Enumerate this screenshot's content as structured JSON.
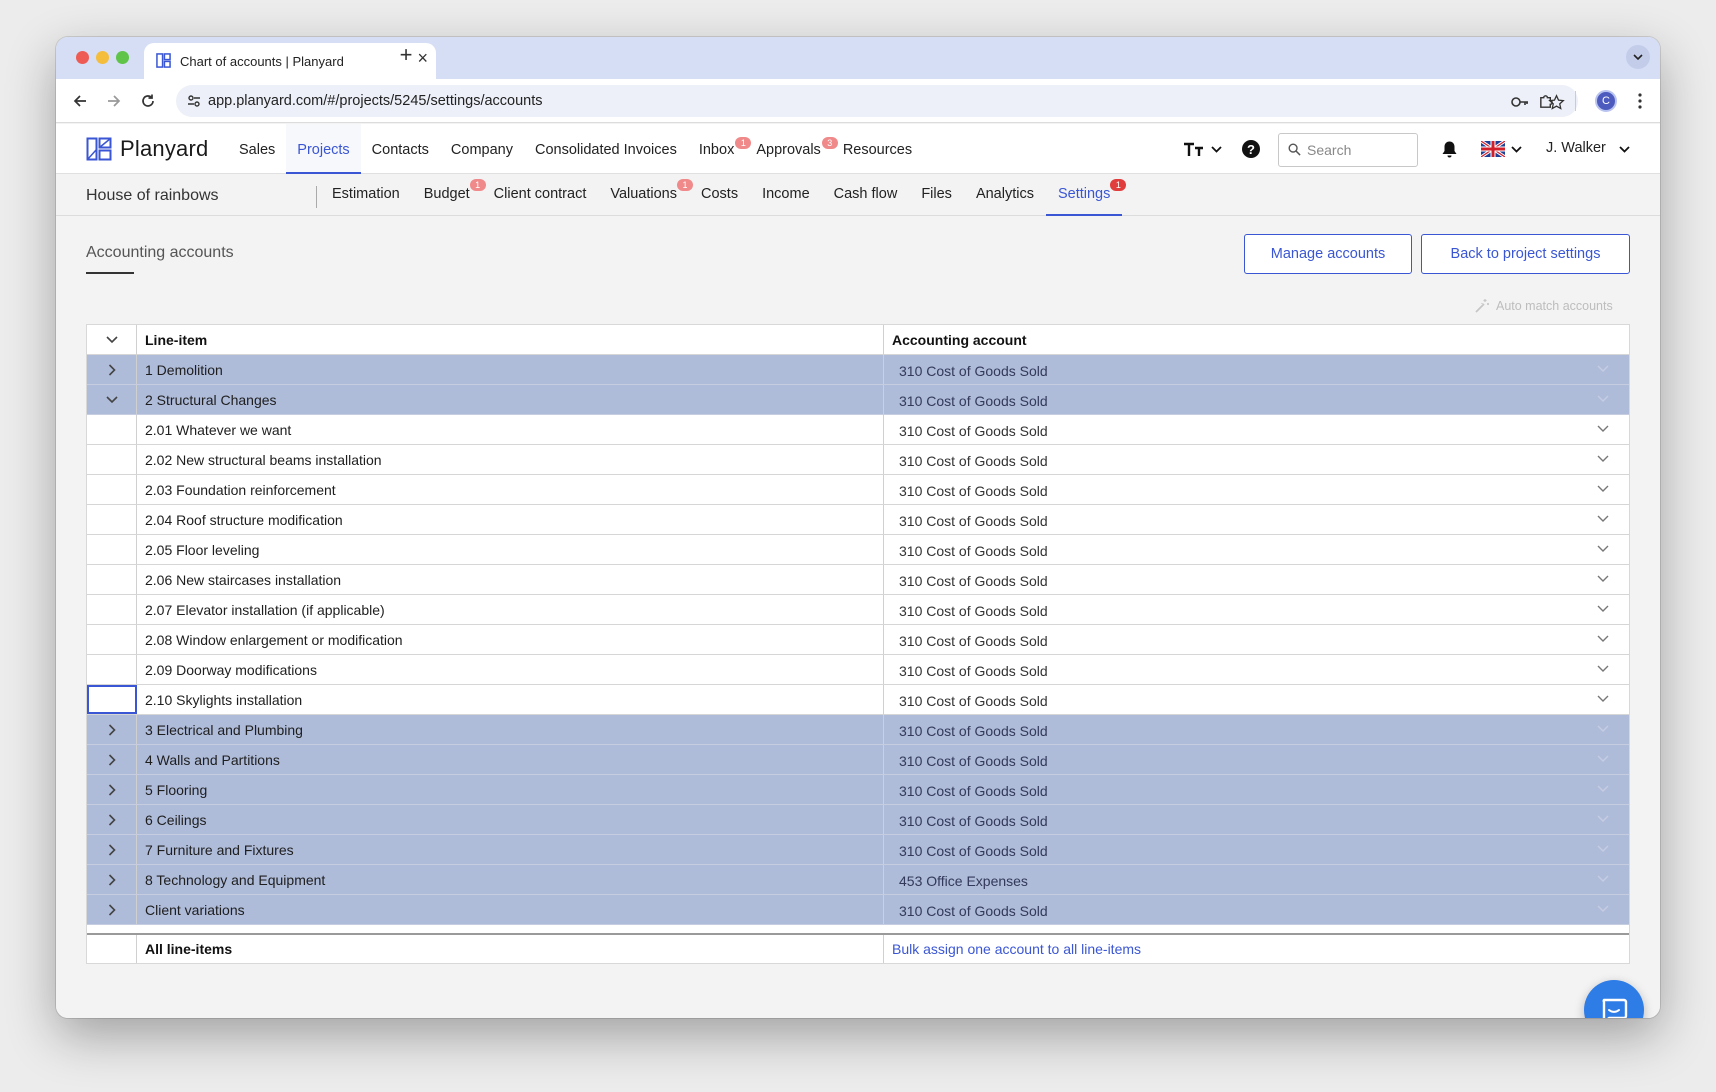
{
  "browser": {
    "tab_title": "Chart of accounts | Planyard",
    "url": "app.planyard.com/#/projects/5245/settings/accounts",
    "profile_initial": "C",
    "icons": [
      "back-arrow-icon",
      "forward-arrow-icon",
      "reload-icon",
      "site-settings-icon",
      "key-icon",
      "star-icon",
      "extensions-icon",
      "more-vert-icon"
    ]
  },
  "app": {
    "brand": "Planyard",
    "main_nav": [
      {
        "label": "Sales",
        "badge": ""
      },
      {
        "label": "Projects",
        "badge": ""
      },
      {
        "label": "Contacts",
        "badge": ""
      },
      {
        "label": "Company",
        "badge": ""
      },
      {
        "label": "Consolidated Invoices",
        "badge": ""
      },
      {
        "label": "Inbox",
        "badge": "1"
      },
      {
        "label": "Approvals",
        "badge": "3"
      },
      {
        "label": "Resources",
        "badge": ""
      }
    ],
    "search_placeholder": "Search",
    "user_name": "J. Walker",
    "accent_color": "#3a56d4"
  },
  "project": {
    "name": "House of rainbows",
    "sub_nav": [
      {
        "label": "Estimation",
        "badge": ""
      },
      {
        "label": "Budget",
        "badge": "1"
      },
      {
        "label": "Client contract",
        "badge": ""
      },
      {
        "label": "Valuations",
        "badge": "1"
      },
      {
        "label": "Costs",
        "badge": ""
      },
      {
        "label": "Income",
        "badge": ""
      },
      {
        "label": "Cash flow",
        "badge": ""
      },
      {
        "label": "Files",
        "badge": ""
      },
      {
        "label": "Analytics",
        "badge": ""
      },
      {
        "label": "Settings",
        "badge": "1"
      }
    ]
  },
  "page": {
    "title": "Accounting accounts",
    "manage_button": "Manage accounts",
    "back_button": "Back to project settings",
    "auto_match": "Auto match accounts"
  },
  "table": {
    "col_line_item": "Line-item",
    "col_account": "Accounting account",
    "rows": [
      {
        "label": "1 Demolition",
        "account": "310 Cost of Goods Sold",
        "group": true,
        "expanded": false
      },
      {
        "label": "2 Structural Changes",
        "account": "310 Cost of Goods Sold",
        "group": true,
        "expanded": true
      },
      {
        "label": "2.01 Whatever we want",
        "account": "310 Cost of Goods Sold",
        "group": false
      },
      {
        "label": "2.02 New structural beams installation",
        "account": "310 Cost of Goods Sold",
        "group": false
      },
      {
        "label": "2.03 Foundation reinforcement",
        "account": "310 Cost of Goods Sold",
        "group": false
      },
      {
        "label": "2.04 Roof structure modification",
        "account": "310 Cost of Goods Sold",
        "group": false
      },
      {
        "label": "2.05 Floor leveling",
        "account": "310 Cost of Goods Sold",
        "group": false
      },
      {
        "label": "2.06 New staircases installation",
        "account": "310 Cost of Goods Sold",
        "group": false
      },
      {
        "label": "2.07 Elevator installation (if applicable)",
        "account": "310 Cost of Goods Sold",
        "group": false
      },
      {
        "label": "2.08 Window enlargement or modification",
        "account": "310 Cost of Goods Sold",
        "group": false
      },
      {
        "label": "2.09 Doorway modifications",
        "account": "310 Cost of Goods Sold",
        "group": false
      },
      {
        "label": "2.10 Skylights installation",
        "account": "310 Cost of Goods Sold",
        "group": false
      },
      {
        "label": "3 Electrical and Plumbing",
        "account": "310 Cost of Goods Sold",
        "group": true,
        "expanded": false
      },
      {
        "label": "4 Walls and Partitions",
        "account": "310 Cost of Goods Sold",
        "group": true,
        "expanded": false
      },
      {
        "label": "5 Flooring",
        "account": "310 Cost of Goods Sold",
        "group": true,
        "expanded": false
      },
      {
        "label": "6 Ceilings",
        "account": "310 Cost of Goods Sold",
        "group": true,
        "expanded": false
      },
      {
        "label": "7 Furniture and Fixtures",
        "account": "310 Cost of Goods Sold",
        "group": true,
        "expanded": false
      },
      {
        "label": "8 Technology and Equipment",
        "account": "453 Office Expenses",
        "group": true,
        "expanded": false
      },
      {
        "label": "Client variations",
        "account": "310 Cost of Goods Sold",
        "group": true,
        "expanded": false
      }
    ],
    "footer_label": "All line-items",
    "footer_action": "Bulk assign one account to all line-items"
  }
}
